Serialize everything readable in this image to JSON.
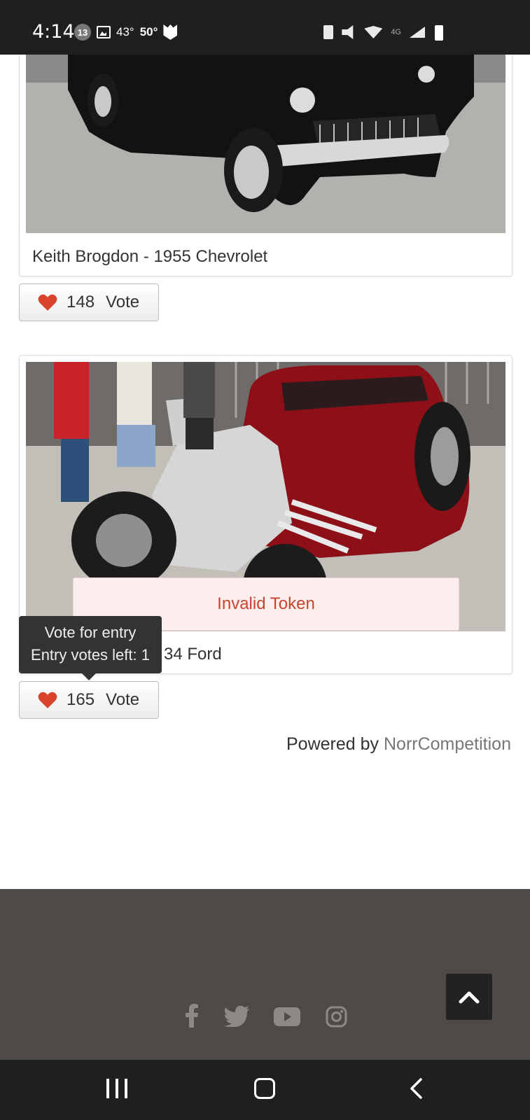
{
  "status_bar": {
    "time": "4:14",
    "badge": "13",
    "temp": "43°",
    "temp_low": "50°",
    "network": "4G"
  },
  "entries": [
    {
      "caption": "Keith Brogdon - 1955 Chevrolet",
      "votes": "148",
      "vote_label": "Vote"
    },
    {
      "caption": "34 Ford",
      "votes": "165",
      "vote_label": "Vote",
      "alert": "Invalid Token"
    }
  ],
  "tooltip": {
    "line1": "Vote for entry",
    "line2": "Entry votes left: 1"
  },
  "footer": {
    "powered_prefix": "Powered by",
    "powered_brand": "NorrCompetition",
    "social_icons": [
      "facebook-icon",
      "twitter-icon",
      "youtube-icon",
      "instagram-icon"
    ]
  },
  "colors": {
    "accent_heart": "#d9442b",
    "alert_text": "#c9442b",
    "footer_bg": "#4e4a47"
  }
}
